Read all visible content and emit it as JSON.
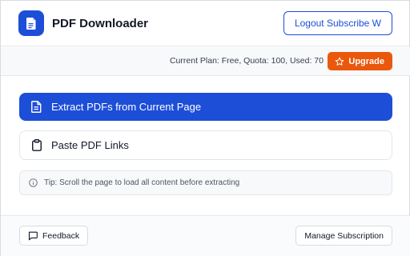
{
  "header": {
    "title": "PDF Downloader",
    "logout_label": "Logout Subscribe W",
    "logo_icon": "document-icon"
  },
  "plan": {
    "status_text": "Current Plan: Free, Quota: 100, Used: 70",
    "upgrade_label": "Upgrade",
    "upgrade_icon": "star-icon"
  },
  "main": {
    "extract_label": "Extract PDFs from Current Page",
    "extract_icon": "file-text-icon",
    "paste_label": "Paste PDF Links",
    "paste_icon": "clipboard-icon",
    "tip_text": "Tip: Scroll the page to load all content before extracting",
    "tip_icon": "info-icon"
  },
  "footer": {
    "feedback_label": "Feedback",
    "feedback_icon": "message-square-icon",
    "manage_label": "Manage Subscription"
  },
  "colors": {
    "primary": "#1d4ed8",
    "upgrade": "#ea580c",
    "border": "#e5e7eb"
  }
}
